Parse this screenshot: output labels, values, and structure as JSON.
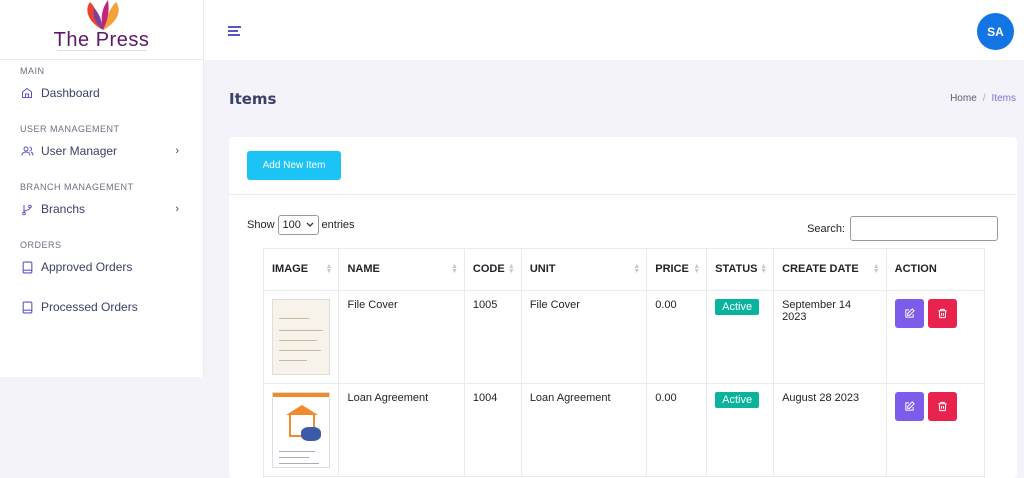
{
  "brand": {
    "name": "The Press"
  },
  "sidebar": {
    "sections": [
      {
        "title": "MAIN",
        "items": [
          {
            "label": "Dashboard",
            "icon": "home-icon",
            "chevron": false
          }
        ]
      },
      {
        "title": "USER MANAGEMENT",
        "items": [
          {
            "label": "User Manager",
            "icon": "users-icon",
            "chevron": true
          }
        ]
      },
      {
        "title": "BRANCH MANAGEMENT",
        "items": [
          {
            "label": "Branchs",
            "icon": "git-branch-icon",
            "chevron": true
          }
        ]
      },
      {
        "title": "ORDERS",
        "items": [
          {
            "label": "Approved Orders",
            "icon": "tablet-icon",
            "chevron": false
          },
          {
            "label": "Processed Orders",
            "icon": "tablet-icon",
            "chevron": false
          }
        ]
      }
    ]
  },
  "topbar": {
    "avatar_initials": "SA"
  },
  "page": {
    "title": "Items",
    "breadcrumb": {
      "home": "Home",
      "separator": "/",
      "current": "Items"
    }
  },
  "toolbar": {
    "add_label": "Add New Item"
  },
  "table_controls": {
    "show_label": "Show",
    "entries_value": "100",
    "entries_label": "entries",
    "search_label": "Search:"
  },
  "table": {
    "columns": [
      "IMAGE",
      "NAME",
      "CODE",
      "UNIT",
      "PRICE",
      "STATUS",
      "CREATE DATE",
      "ACTION"
    ],
    "rows": [
      {
        "name": "File Cover",
        "code": "1005",
        "unit": "File Cover",
        "price": "0.00",
        "status": "Active",
        "date": "September 14 2023"
      },
      {
        "name": "Loan Agreement",
        "code": "1004",
        "unit": "Loan Agreement",
        "price": "0.00",
        "status": "Active",
        "date": "August 28 2023"
      }
    ]
  },
  "colors": {
    "accent": "#5a55c7",
    "add_button": "#1cc4f5",
    "status_active": "#0ab39c",
    "edit": "#7c5ce8",
    "delete": "#e8244e",
    "avatar": "#1275e3"
  }
}
